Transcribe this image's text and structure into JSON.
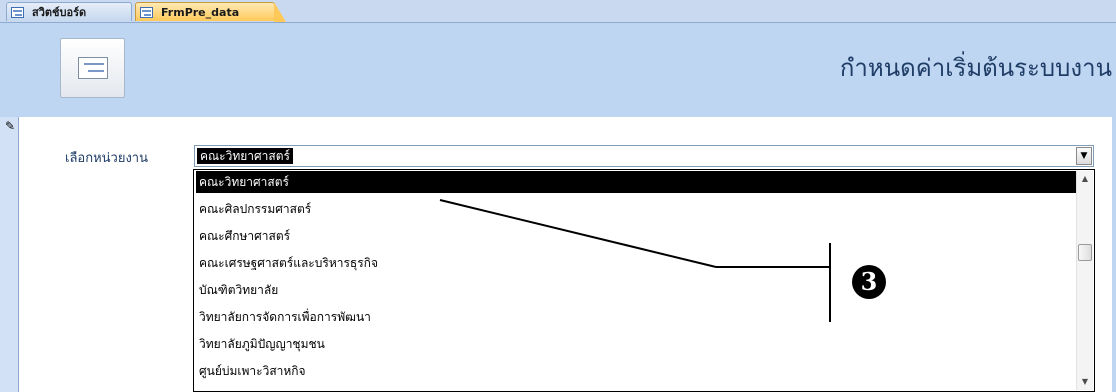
{
  "tabs": [
    {
      "label": "สวิตช์บอร์ด",
      "icon": "form-icon",
      "active": false
    },
    {
      "label": "FrmPre_data",
      "icon": "form-icon",
      "active": true
    }
  ],
  "header": {
    "icon": "form-icon",
    "title": "กำหนดค่าเริ่มต้นระบบงาน"
  },
  "record_selector": {
    "icon": "pencil-icon",
    "glyph": "✎"
  },
  "field": {
    "label": "เลือกหน่วยงาน",
    "value": "คณะวิทยาศาสตร์",
    "dropdown_arrow": "▼"
  },
  "dropdown": {
    "items": [
      "คณะวิทยาศาสตร์",
      "คณะศิลปกรรมศาสตร์",
      "คณะศึกษาศาสตร์",
      "คณะเศรษฐศาสตร์และบริหารธุรกิจ",
      "บัณฑิตวิทยาลัย",
      "วิทยาลัยการจัดการเพื่อการพัฒนา",
      "วิทยาลัยภูมิปัญญาชุมชน",
      "ศูนย์บ่มเพาะวิสาหกิจ"
    ],
    "selected_index": 0,
    "scroll_up": "▲",
    "scroll_down": "▼"
  },
  "annotation": {
    "number": "3"
  },
  "colors": {
    "tab_active": "#ffc95a",
    "header_band": "#bfd6f2",
    "title_text": "#1f3d66",
    "selection": "#000000"
  }
}
